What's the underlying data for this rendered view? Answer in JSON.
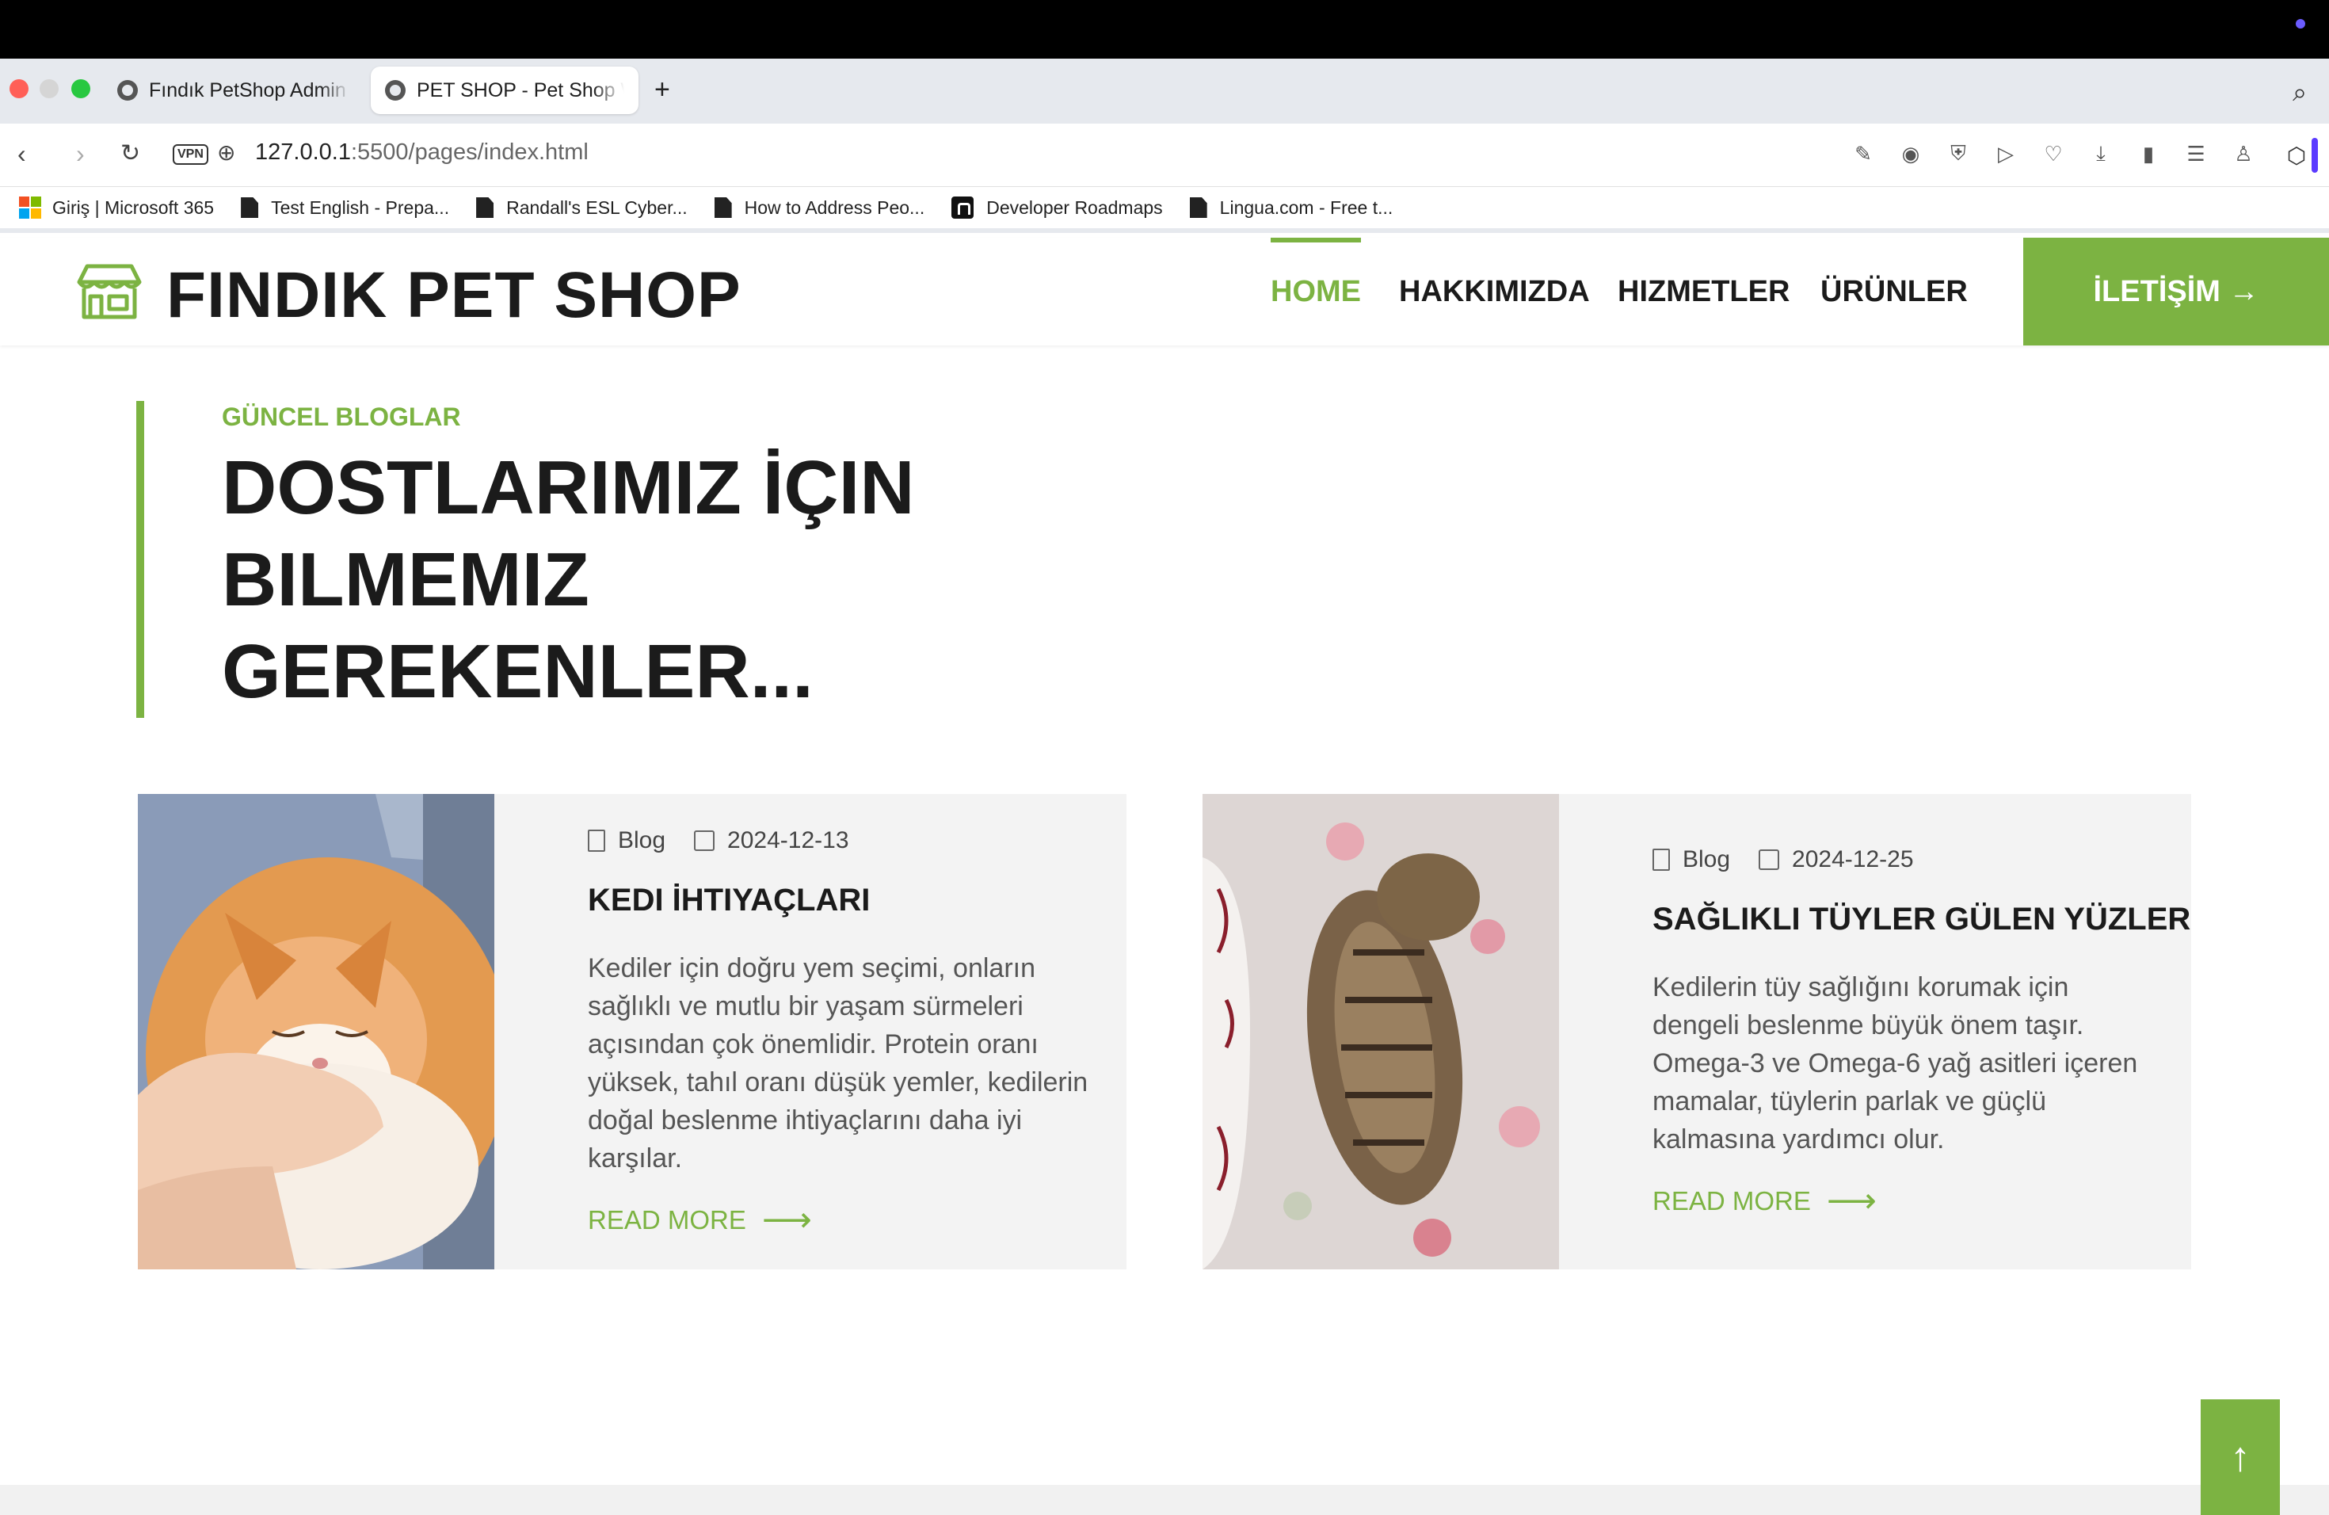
{
  "browser": {
    "tabs": [
      {
        "title": "Fındık PetShop Admin Pa",
        "active": false
      },
      {
        "title": "PET SHOP - Pet Shop Website",
        "active": true
      }
    ],
    "url_host": "127.0.0.1",
    "url_rest": ":5500/pages/index.html",
    "vpn_label": "VPN",
    "bookmarks": [
      {
        "label": "Giriş | Microsoft 365",
        "icon": "microsoft-icon"
      },
      {
        "label": "Test English - Prepa...",
        "icon": "page-icon"
      },
      {
        "label": "Randall's ESL Cyber...",
        "icon": "page-icon"
      },
      {
        "label": "How to Address Peo...",
        "icon": "page-icon"
      },
      {
        "label": "Developer Roadmaps",
        "icon": "roadmap-icon"
      },
      {
        "label": "Lingua.com - Free t...",
        "icon": "page-icon"
      }
    ]
  },
  "site": {
    "brand": "FINDIK PET SHOP",
    "nav": [
      "HOME",
      "HAKKIMIZDA",
      "HIZMETLER",
      "ÜRÜNLER"
    ],
    "contact_label": "İLETİŞİM →",
    "accent": "#7cb342"
  },
  "section": {
    "subtitle": "GÜNCEL BLOGLAR",
    "title_lines": [
      "DOSTLARIMIZ İÇIN",
      "BILMEMIZ",
      "GEREKENLER..."
    ]
  },
  "posts": [
    {
      "category": "Blog",
      "date": "2024-12-13",
      "title": "KEDI İHTIYAÇLARI",
      "desc": "Kediler için doğru yem seçimi, onların sağlıklı ve mutlu bir yaşam sürmeleri açısından çok önemlidir. Protein oranı yüksek, tahıl oranı düşük yemler, kedilerin doğal beslenme ihtiyaçlarını daha iyi karşılar.",
      "read_more": "READ MORE"
    },
    {
      "category": "Blog",
      "date": "2024-12-25",
      "title": "SAĞLIKLI TÜYLER GÜLEN YÜZLER",
      "desc": "Kedilerin tüy sağlığını korumak için dengeli beslenme büyük önem taşır. Omega-3 ve Omega-6 yağ asitleri içeren mamalar, tüylerin parlak ve güçlü kalmasına yardımcı olur.",
      "read_more": "READ MORE"
    }
  ],
  "to_top": "↑"
}
